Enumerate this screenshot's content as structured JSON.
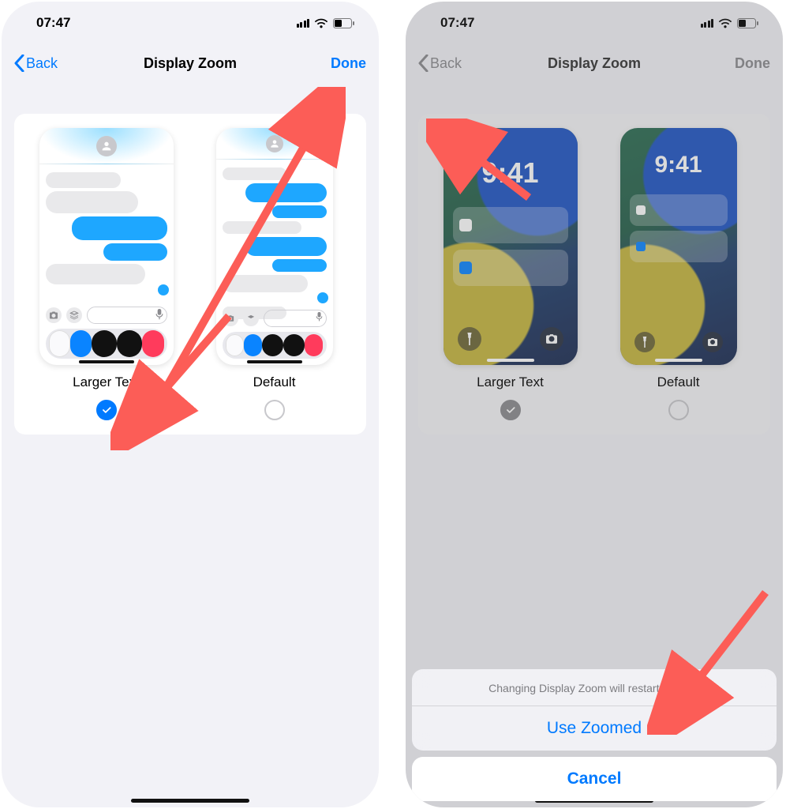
{
  "status": {
    "time": "07:47"
  },
  "nav": {
    "back": "Back",
    "title": "Display Zoom",
    "done": "Done"
  },
  "options": {
    "larger": {
      "label": "Larger Text"
    },
    "default": {
      "label": "Default"
    }
  },
  "lock": {
    "time": "9:41"
  },
  "sheet": {
    "message": "Changing Display Zoom will restart iPhone.",
    "primary": "Use Zoomed",
    "cancel": "Cancel"
  }
}
